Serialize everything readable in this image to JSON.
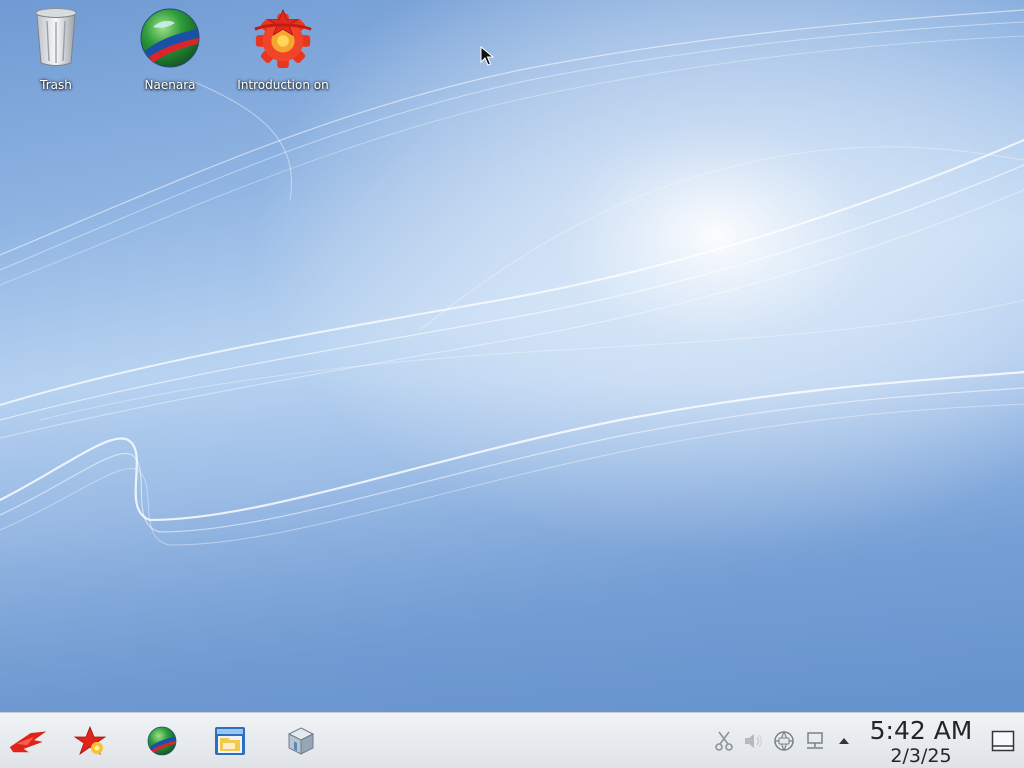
{
  "desktop": {
    "icons": [
      {
        "label": "Trash",
        "icon": "trash-icon"
      },
      {
        "label": "Naenara",
        "icon": "globe-icon"
      },
      {
        "label": "Introduction on",
        "icon": "gear-star-icon"
      }
    ]
  },
  "panel": {
    "launchers": [
      {
        "icon": "application-menu-icon"
      },
      {
        "icon": "red-star-icon"
      },
      {
        "icon": "globe-icon"
      },
      {
        "icon": "file-manager-icon"
      },
      {
        "icon": "package-box-icon"
      }
    ],
    "tray": [
      {
        "icon": "clipboard-scissors-icon"
      },
      {
        "icon": "volume-icon"
      },
      {
        "icon": "network-globe-icon"
      },
      {
        "icon": "network-computer-icon"
      },
      {
        "icon": "expand-up-arrow-icon"
      }
    ],
    "clock": {
      "time": "5:42 AM",
      "date": "2/3/25"
    },
    "show_desktop": {
      "icon": "show-desktop-icon"
    }
  },
  "colors": {
    "wallpaper_base": "#7ea6da",
    "wallpaper_highlight": "#ffffff",
    "panel_background": "#e6e9ed",
    "clock_text": "#232629"
  }
}
